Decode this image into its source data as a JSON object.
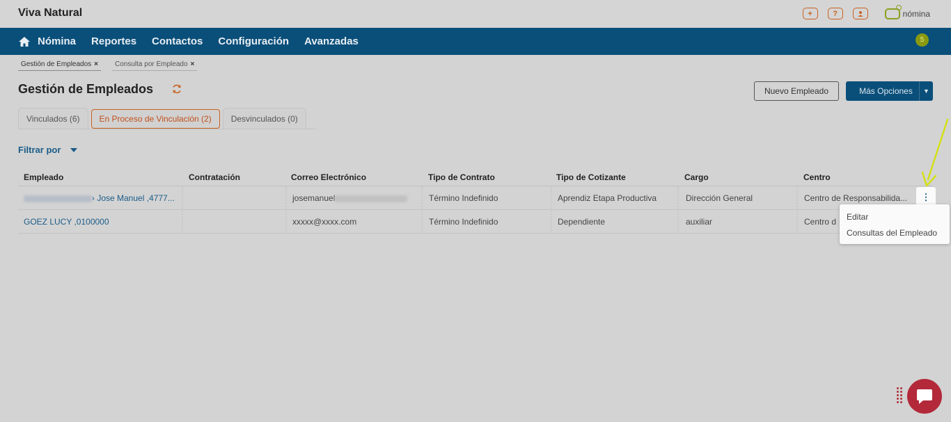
{
  "app": {
    "title": "Viva Natural",
    "brand_label": "nómina"
  },
  "header": {
    "icons": [
      "plus-icon",
      "help-icon",
      "user-icon"
    ],
    "plus_glyph": "+",
    "help_glyph": "?"
  },
  "nav": {
    "items": [
      "Nómina",
      "Reportes",
      "Contactos",
      "Configuración",
      "Avanzadas"
    ],
    "badge": "5"
  },
  "page_tabs": [
    {
      "label": "Gestión de Empleados",
      "close": "×"
    },
    {
      "label": "Consulta por Empleado",
      "close": "×"
    }
  ],
  "page": {
    "title": "Gestión de Empleados",
    "nuevo_label": "Nuevo Empleado",
    "mas_label": "Más Opciones"
  },
  "status_tabs": [
    "Vinculados (6)",
    "En Proceso de Vinculación (2)",
    "Desvinculados (0)"
  ],
  "filter": {
    "label": "Filtrar por"
  },
  "table": {
    "columns": [
      "Empleado",
      "Contratación",
      "Correo Electrónico",
      "Tipo de Contrato",
      "Tipo de Cotizante",
      "Cargo",
      "Centro"
    ],
    "rows": [
      {
        "empleado": "› Jose Manuel ,4777...",
        "contratacion": "",
        "correo": "josemanuel",
        "tipo_contrato": "Término Indefinido",
        "cotizante": "Aprendiz Etapa Productiva",
        "cargo": "Dirección General",
        "centro": "Centro de Responsabilida..."
      },
      {
        "empleado": "GOEZ LUCY ,0100000",
        "contratacion": "",
        "correo": "xxxxx@xxxx.com",
        "tipo_contrato": "Término Indefinido",
        "cotizante": "Dependiente",
        "cargo": "auxiliar",
        "centro": "Centro d"
      }
    ]
  },
  "row_menu": {
    "kebab_glyph": "⋮",
    "items": [
      "Editar",
      "Consultas del Empleado"
    ]
  },
  "colors": {
    "nav_bg": "#0a4f7a",
    "accent_orange": "#c9611f",
    "link_blue": "#1a5c88",
    "arrow": "#d4e011",
    "chat": "#b3293a"
  }
}
